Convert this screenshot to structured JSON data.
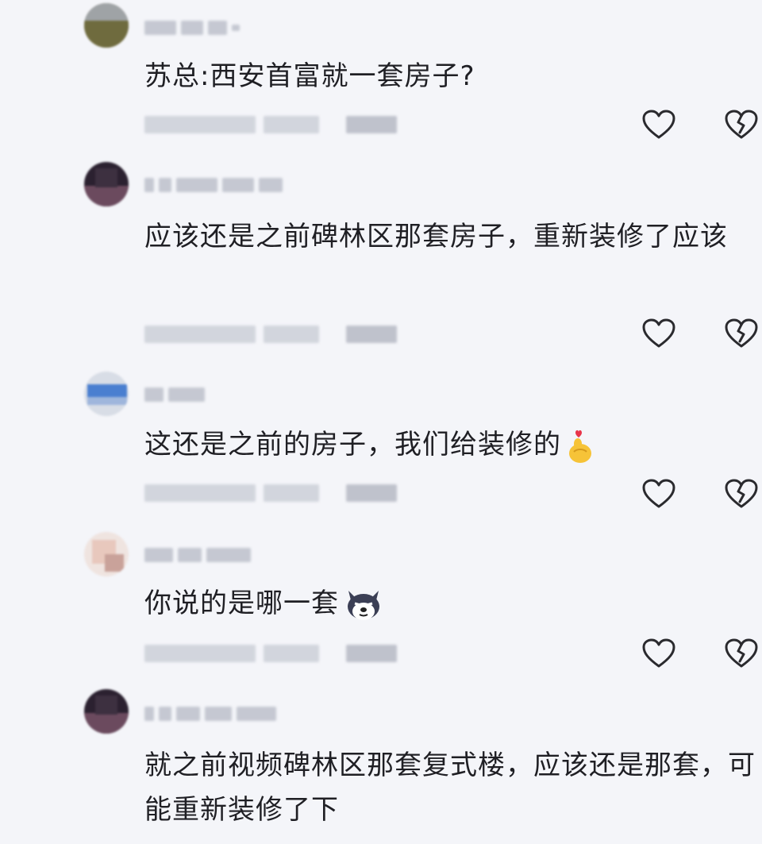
{
  "comments": [
    {
      "text": "苏总:西安首富就一套房子?"
    },
    {
      "text": "应该还是之前碑林区那套房子，重新装修了应该"
    },
    {
      "text": "这还是之前的房子，我们给装修的"
    },
    {
      "text": "你说的是哪一套"
    },
    {
      "text": "就之前视频碑林区那套复式楼，应该还是那套，可能重新装修了下"
    }
  ],
  "icons": {
    "like": "heart-outline-icon",
    "dislike": "broken-heart-icon",
    "emoji_3": "finger-heart-emoji",
    "emoji_4": "husky-dog-emoji"
  },
  "colors": {
    "background": "#f4f5f9",
    "text": "#1f1f24",
    "icon_stroke": "#2a2a2e",
    "blur_block": "#c5c8d2"
  }
}
